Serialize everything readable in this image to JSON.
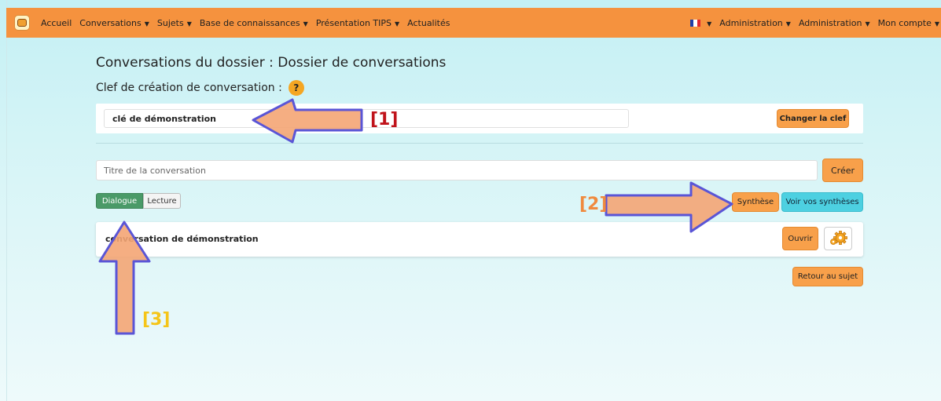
{
  "nav": {
    "items": [
      {
        "label": "Accueil",
        "caret": false
      },
      {
        "label": "Conversations",
        "caret": true
      },
      {
        "label": "Sujets",
        "caret": true
      },
      {
        "label": "Base de connaissances",
        "caret": true
      },
      {
        "label": "Présentation TIPS",
        "caret": true
      },
      {
        "label": "Actualités",
        "caret": false
      }
    ],
    "right": [
      "Administration",
      "Administration",
      "Mon compte"
    ],
    "caret": "▼"
  },
  "page": {
    "title": "Conversations du dossier : Dossier de conversations",
    "key_label": "Clef de création de conversation :",
    "help": "?",
    "key_value": "clé de démonstration",
    "change_key": "Changer la clef",
    "title_placeholder": "Titre de la conversation",
    "create": "Créer",
    "toggle_dialogue": "Dialogue",
    "toggle_lecture": "Lecture",
    "synthese": "Synthèse",
    "voir_syntheses": "Voir vos synthèses",
    "conversation_title": "conversation de démonstration",
    "open": "Ouvrir",
    "back": "Retour au sujet"
  },
  "annotations": {
    "label_1": "[1]",
    "label_2": "[2]",
    "label_3": "[3]",
    "color_1": "#c0131b",
    "color_2": "#f08a3e",
    "color_3": "#f5c518"
  },
  "colors": {
    "navbar": "#f5923e",
    "accent_orange": "#f8a04a",
    "accent_cyan": "#4dd0e1",
    "active_green": "#4a9a68"
  }
}
